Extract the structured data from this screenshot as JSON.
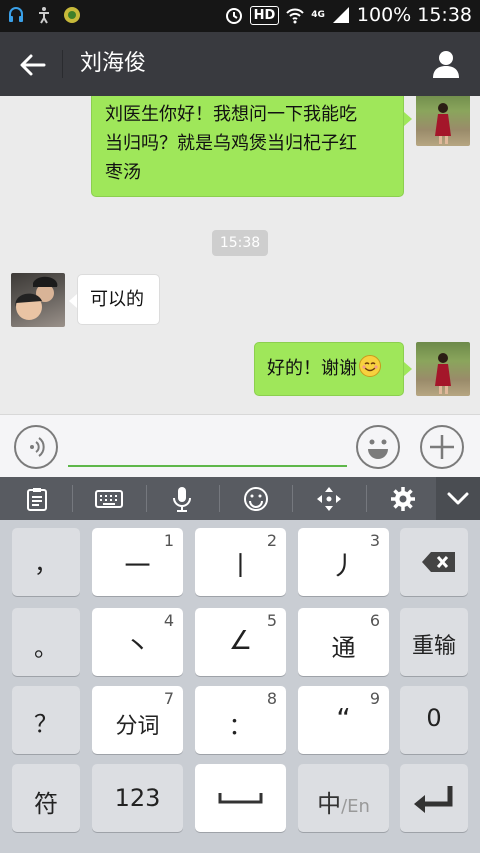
{
  "status_bar": {
    "hd": "HD",
    "network": "4G",
    "battery": "100%",
    "time": "15:38"
  },
  "header": {
    "title": "刘海俊"
  },
  "messages": [
    {
      "side": "right",
      "text_line1": "刘医生你好！我想问一下我能吃",
      "text_line2": "当归吗？就是乌鸡煲当归杞子红",
      "text_line3": "枣汤"
    },
    {
      "time": "15:38"
    },
    {
      "side": "left",
      "text": "可以的"
    },
    {
      "side": "right",
      "text": "好的！谢谢"
    }
  ],
  "input": {
    "value": "",
    "placeholder": ""
  },
  "keyboard": {
    "toolbar_icons": [
      "clipboard-icon",
      "keyboard-icon",
      "microphone-icon",
      "smiley-icon",
      "cursor-move-icon",
      "gear-icon",
      "chevron-down-icon"
    ],
    "row1": {
      "k1": "，",
      "k2": "一",
      "k2n": "1",
      "k3": "丨",
      "k3n": "2",
      "k4": "丿",
      "k4n": "3"
    },
    "row2": {
      "k1": "。",
      "k2": "丶",
      "k2n": "4",
      "k3": "∠",
      "k3n": "5",
      "k4": "通",
      "k4n": "6",
      "k5": "重输"
    },
    "row3": {
      "k1": "？",
      "k2": "分词",
      "k2n": "7",
      "k3": "：",
      "k3n": "8",
      "k4": "“",
      "k4n": "9",
      "k5": "0"
    },
    "row4": {
      "k1": "符",
      "k2": "123",
      "k4a": "中",
      "k4b": "/En"
    }
  },
  "colors": {
    "header_bg": "#393a3f",
    "my_bubble": "#9fe75a",
    "input_underline": "#5eb74a"
  }
}
